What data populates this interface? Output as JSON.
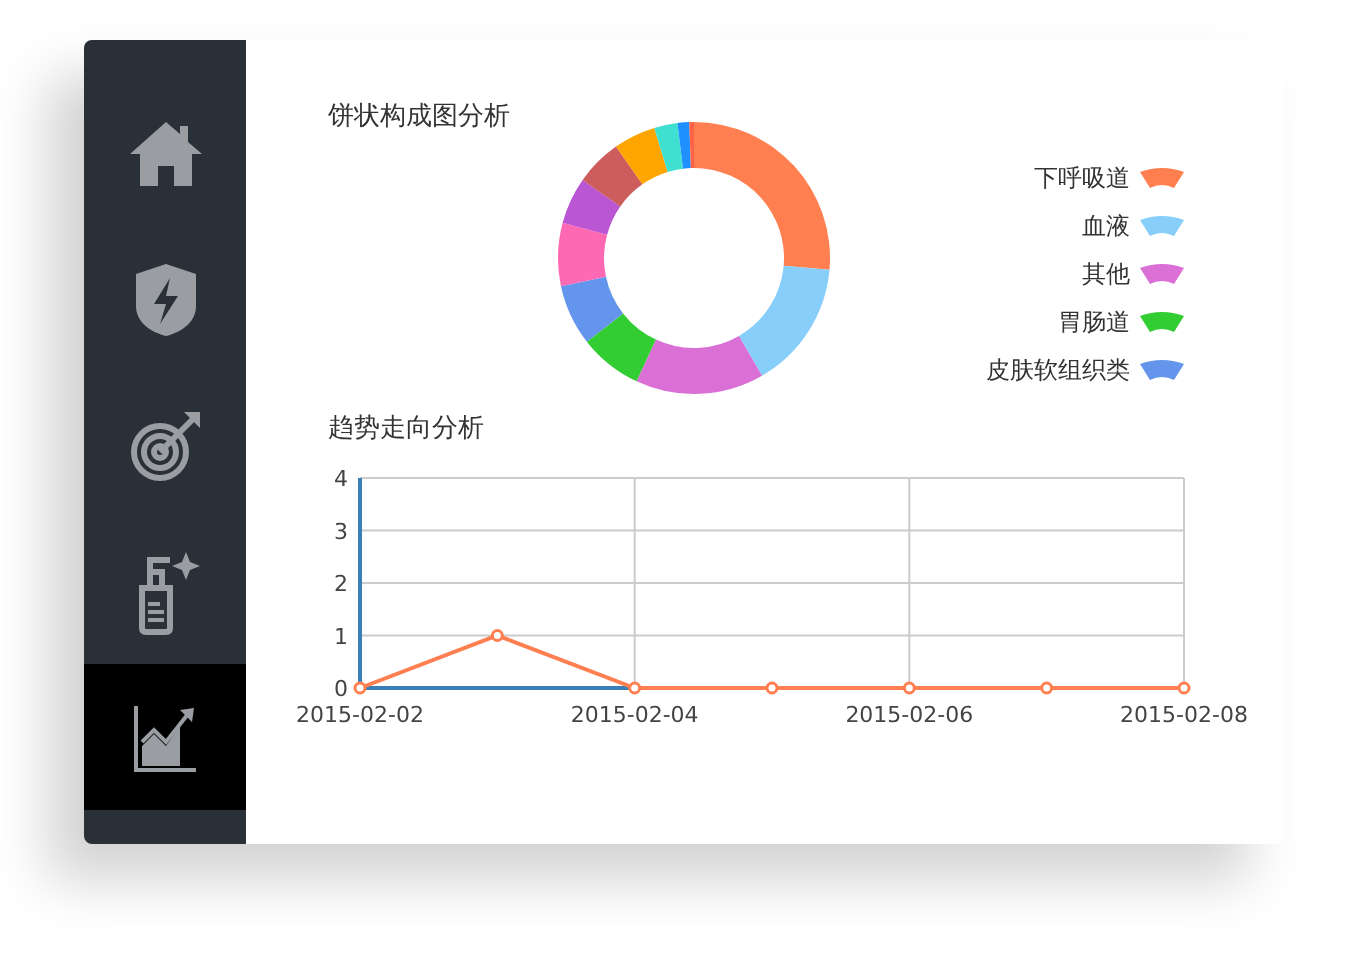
{
  "sidebar": {
    "items": [
      {
        "selected": false
      },
      {
        "selected": false
      },
      {
        "selected": false
      },
      {
        "selected": false
      },
      {
        "selected": true
      }
    ]
  },
  "pie_panel": {
    "title": "饼状构成图分析",
    "legend": [
      {
        "label": "下呼吸道",
        "color": "#ff7f50"
      },
      {
        "label": "血液",
        "color": "#87cefa"
      },
      {
        "label": "其他",
        "color": "#da70d6"
      },
      {
        "label": "胃肠道",
        "color": "#32cd32"
      },
      {
        "label": "皮肤软组织类",
        "color": "#6495ed"
      }
    ]
  },
  "trend_panel": {
    "title": "趋势走向分析",
    "chart_data": {
      "type": "line",
      "categories": [
        "2015-02-02",
        null,
        "2015-02-04",
        null,
        "2015-02-06",
        null,
        "2015-02-08"
      ],
      "series": [
        {
          "color": "#ff7f50",
          "marker": "circle",
          "values": [
            0,
            1,
            0,
            0,
            0,
            0,
            0
          ]
        }
      ],
      "ylim": [
        0,
        4
      ],
      "yticks": [
        0,
        1,
        2,
        3,
        4
      ],
      "grid": true
    }
  }
}
